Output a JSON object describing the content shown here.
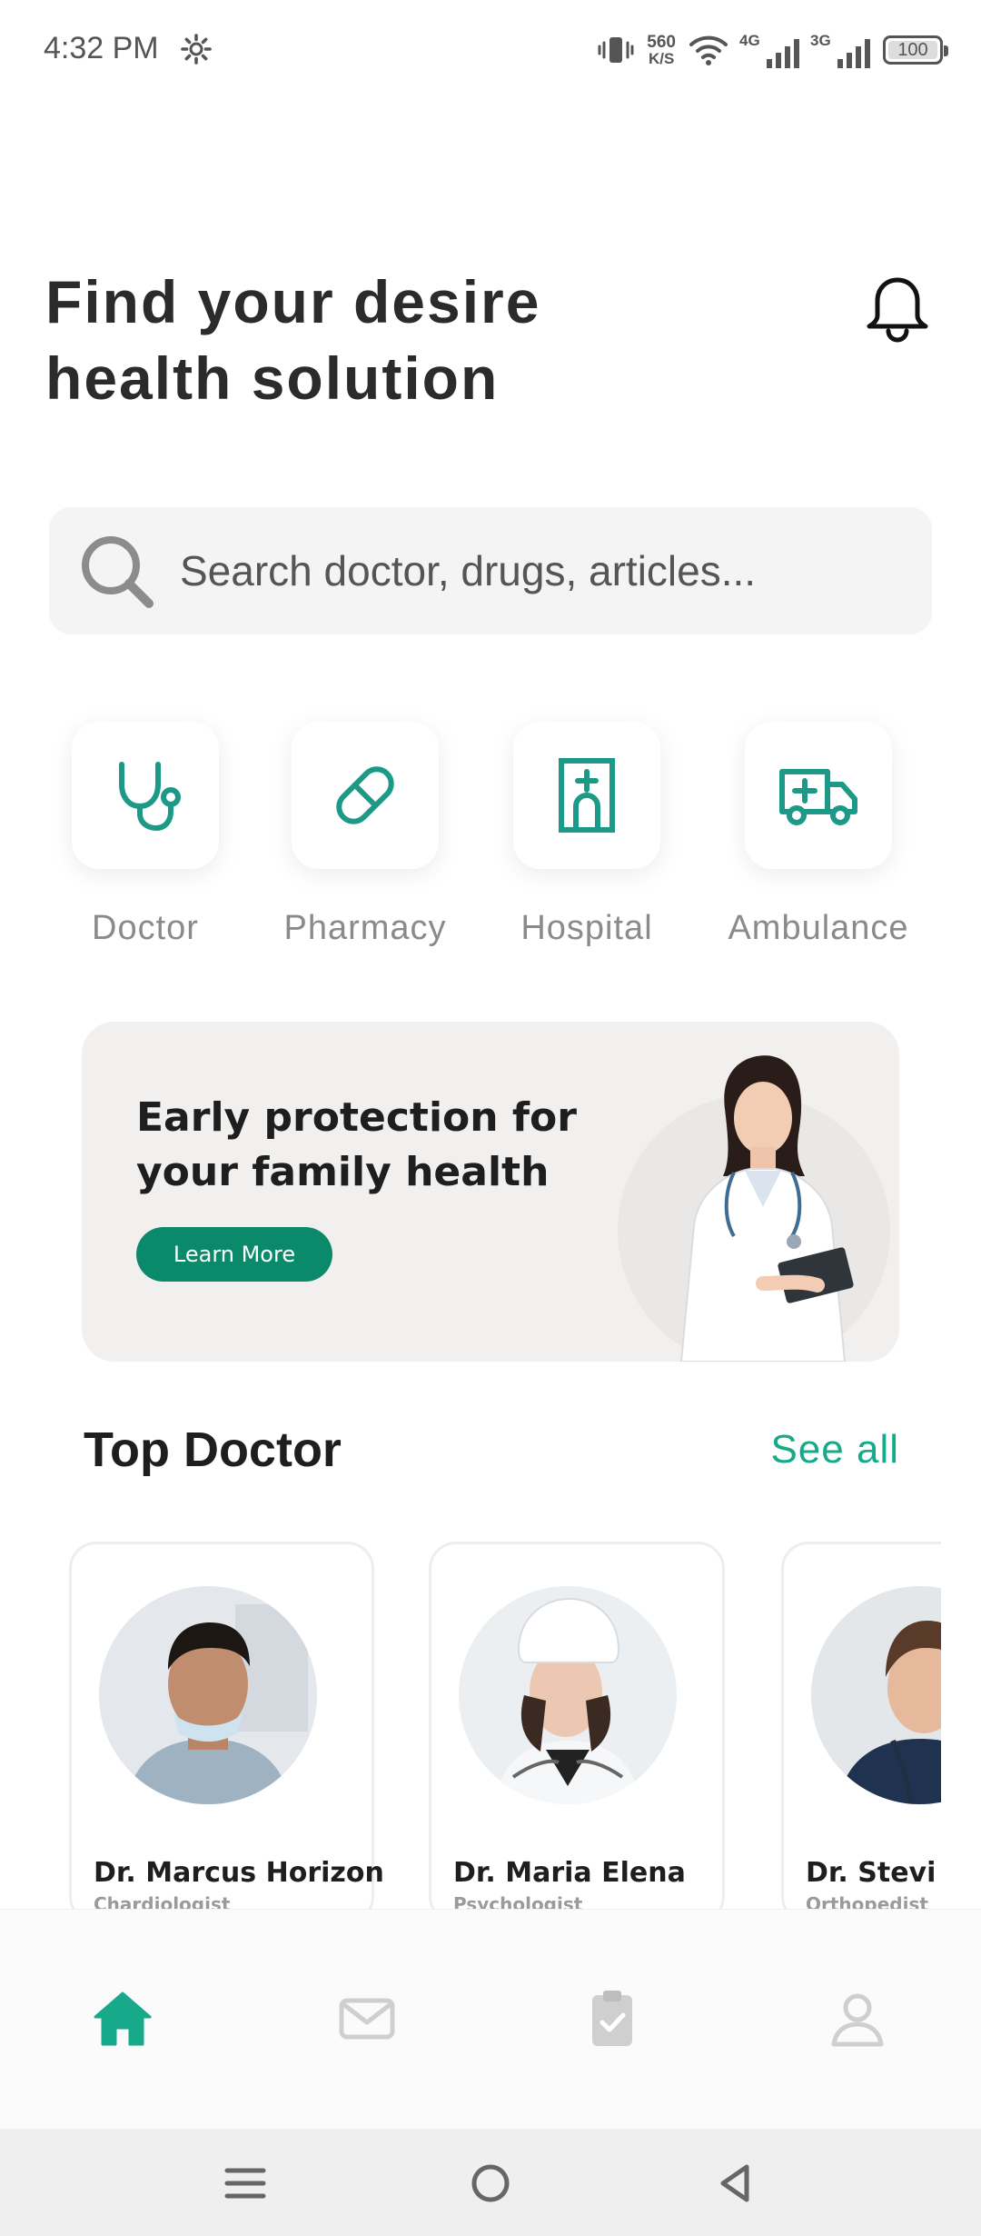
{
  "status_bar": {
    "time": "4:32 PM",
    "icons": [
      "gear-icon",
      "vibrate-icon",
      "wifi-icon",
      "signal-icon",
      "battery-icon"
    ],
    "net_speed_value": "560",
    "net_speed_unit": "K/S",
    "network_1": "4G",
    "network_2": "3G",
    "battery": "100"
  },
  "header": {
    "title": "Find your desire health solution",
    "bell_icon": "bell-icon"
  },
  "search": {
    "placeholder": "Search doctor, drugs, articles...",
    "icon": "search-icon"
  },
  "categories": [
    {
      "label": "Doctor",
      "icon": "stethoscope-icon"
    },
    {
      "label": "Pharmacy",
      "icon": "pill-icon"
    },
    {
      "label": "Hospital",
      "icon": "hospital-icon"
    },
    {
      "label": "Ambulance",
      "icon": "ambulance-icon"
    }
  ],
  "banner": {
    "title": "Early protection for your family health",
    "button_label": "Learn More"
  },
  "top_doctor": {
    "title": "Top Doctor",
    "see_all": "See all",
    "doctors": [
      {
        "name": "Dr. Marcus Horizon",
        "specialty": "Chardiologist"
      },
      {
        "name": "Dr. Maria Elena",
        "specialty": "Psychologist"
      },
      {
        "name": "Dr. Stevi Jessi",
        "specialty": "Orthopedist"
      }
    ]
  },
  "bottom_nav": {
    "items": [
      "home-icon",
      "mail-icon",
      "clipboard-check-icon",
      "profile-icon"
    ],
    "active": "home-icon"
  },
  "colors": {
    "accent": "#16a98a",
    "accent_dark": "#0b8a6b",
    "icon_teal": "#1d9a87",
    "inactive_icon": "#cfcfcf"
  }
}
